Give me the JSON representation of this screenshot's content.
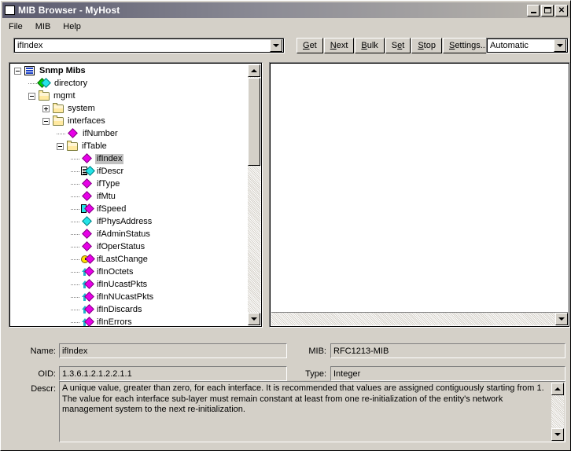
{
  "window": {
    "title": "MIB Browser - MyHost",
    "icon": "app-icon",
    "buttons": {
      "minimize": "_",
      "maximize": "□",
      "close": "✕"
    }
  },
  "menu": {
    "items": [
      "File",
      "MIB",
      "Help"
    ]
  },
  "toolbar": {
    "oid_value": "ifIndex",
    "buttons": [
      {
        "label": "Get",
        "mnemonic": "G"
      },
      {
        "label": "Next",
        "mnemonic": "N"
      },
      {
        "label": "Bulk",
        "mnemonic": "B"
      },
      {
        "label": "Set",
        "mnemonic": "e"
      },
      {
        "label": "Stop",
        "mnemonic": "S"
      },
      {
        "label": "Settings...",
        "mnemonic": "S"
      }
    ],
    "mode_value": "Automatic"
  },
  "tree": {
    "nodes": [
      {
        "label": "Snmp Mibs",
        "depth": 0,
        "toggle": "minus",
        "icon": "grid-icon",
        "bold": true,
        "selected": false
      },
      {
        "label": "directory",
        "depth": 1,
        "toggle": "none",
        "icon": "green-diamond-icon",
        "bold": false,
        "selected": false
      },
      {
        "label": "mgmt",
        "depth": 1,
        "toggle": "minus",
        "icon": "folder-icon",
        "bold": false,
        "selected": false
      },
      {
        "label": "system",
        "depth": 2,
        "toggle": "plus",
        "icon": "folder-icon",
        "bold": false,
        "selected": false
      },
      {
        "label": "interfaces",
        "depth": 2,
        "toggle": "minus",
        "icon": "folder-icon",
        "bold": false,
        "selected": false
      },
      {
        "label": "ifNumber",
        "depth": 3,
        "toggle": "none",
        "icon": "magenta-diamond-icon",
        "bold": false,
        "selected": false
      },
      {
        "label": "ifTable",
        "depth": 3,
        "toggle": "minus",
        "icon": "folder-icon",
        "bold": false,
        "selected": false
      },
      {
        "label": "ifIndex",
        "depth": 4,
        "toggle": "none",
        "icon": "magenta-diamond-icon",
        "bold": false,
        "selected": true
      },
      {
        "label": "ifDescr",
        "depth": 4,
        "toggle": "none",
        "icon": "document-cyan-diamond-icon",
        "bold": false,
        "selected": false
      },
      {
        "label": "ifType",
        "depth": 4,
        "toggle": "none",
        "icon": "magenta-diamond-icon",
        "bold": false,
        "selected": false
      },
      {
        "label": "ifMtu",
        "depth": 4,
        "toggle": "none",
        "icon": "magenta-diamond-icon",
        "bold": false,
        "selected": false
      },
      {
        "label": "ifSpeed",
        "depth": 4,
        "toggle": "none",
        "icon": "gauge-magenta-diamond-icon",
        "bold": false,
        "selected": false
      },
      {
        "label": "ifPhysAddress",
        "depth": 4,
        "toggle": "none",
        "icon": "cyan-diamond-icon",
        "bold": false,
        "selected": false
      },
      {
        "label": "ifAdminStatus",
        "depth": 4,
        "toggle": "none",
        "icon": "magenta-diamond-icon",
        "bold": false,
        "selected": false
      },
      {
        "label": "ifOperStatus",
        "depth": 4,
        "toggle": "none",
        "icon": "magenta-diamond-icon",
        "bold": false,
        "selected": false
      },
      {
        "label": "ifLastChange",
        "depth": 4,
        "toggle": "none",
        "icon": "clock-magenta-diamond-icon",
        "bold": false,
        "selected": false
      },
      {
        "label": "ifInOctets",
        "depth": 4,
        "toggle": "none",
        "icon": "counter-magenta-diamond-icon",
        "bold": false,
        "selected": false
      },
      {
        "label": "ifInUcastPkts",
        "depth": 4,
        "toggle": "none",
        "icon": "counter-magenta-diamond-icon",
        "bold": false,
        "selected": false
      },
      {
        "label": "ifInNUcastPkts",
        "depth": 4,
        "toggle": "none",
        "icon": "counter-magenta-diamond-icon",
        "bold": false,
        "selected": false
      },
      {
        "label": "ifInDiscards",
        "depth": 4,
        "toggle": "none",
        "icon": "counter-magenta-diamond-icon",
        "bold": false,
        "selected": false
      },
      {
        "label": "ifInErrors",
        "depth": 4,
        "toggle": "none",
        "icon": "counter-magenta-diamond-icon",
        "bold": false,
        "selected": false
      }
    ]
  },
  "details": {
    "name_label": "Name:",
    "name_value": "ifIndex",
    "mib_label": "MIB:",
    "mib_value": "RFC1213-MIB",
    "oid_label": "OID:",
    "oid_value": "1.3.6.1.2.1.2.2.1.1",
    "type_label": "Type:",
    "type_value": "Integer",
    "descr_label": "Descr:",
    "descr_value": "A unique value, greater than zero, for each interface.  It is recommended that values are assigned contiguously starting from 1.  The value for each interface sub-layer must remain constant at least from one re-initialization of the entity's network management system to the next re-initialization."
  },
  "colors": {
    "face": "#d4d0c8",
    "magenta": "#e800e8",
    "cyan": "#23e3e8",
    "green": "#00d000",
    "selection": "#c0c0c0",
    "title_start": "#5a5a6e"
  }
}
